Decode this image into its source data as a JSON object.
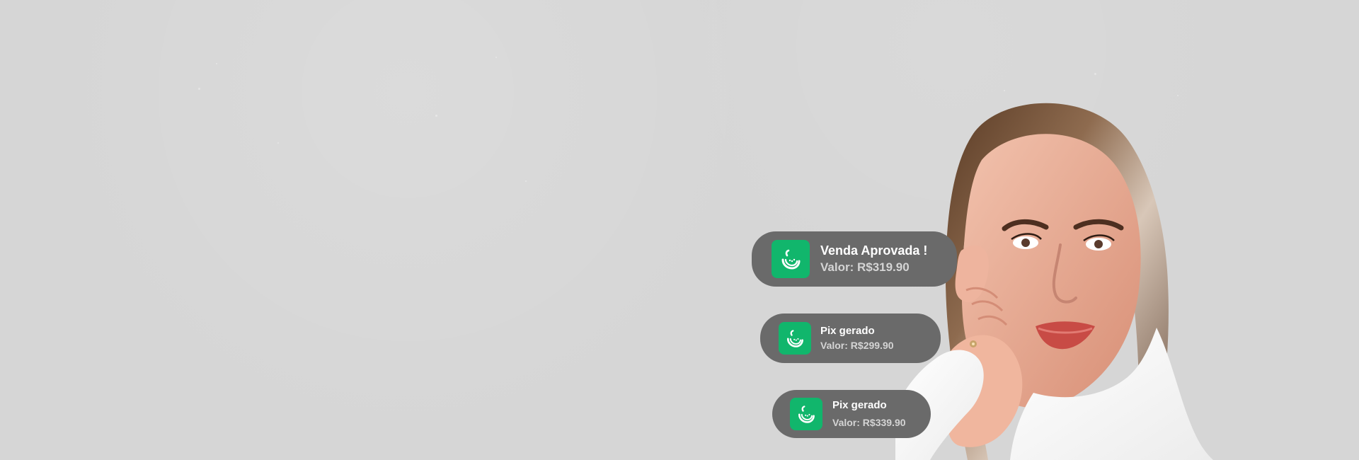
{
  "colors": {
    "background": "#d6d6d6",
    "card_background": "#6a6a6a",
    "icon_background": "#11b66c",
    "title_text": "#ffffff",
    "value_text": "#d4d4d4"
  },
  "notifications": [
    {
      "title": "Venda Aprovada !",
      "value": "Valor: R$319.90",
      "icon": "watermelon-icon"
    },
    {
      "title": "Pix gerado",
      "value": "Valor: R$299.90",
      "icon": "watermelon-icon"
    },
    {
      "title": "Pix gerado",
      "value": "Valor: R$339.90",
      "icon": "watermelon-icon"
    }
  ]
}
